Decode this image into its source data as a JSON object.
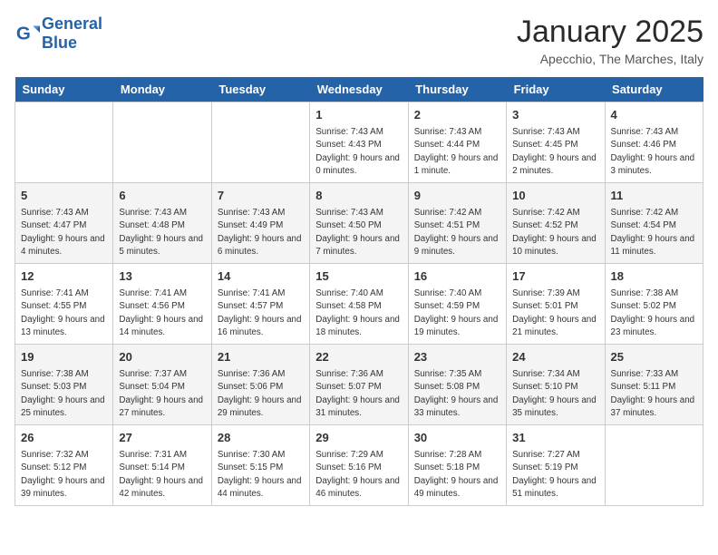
{
  "header": {
    "logo_line1": "General",
    "logo_line2": "Blue",
    "month_title": "January 2025",
    "location": "Apecchio, The Marches, Italy"
  },
  "weekdays": [
    "Sunday",
    "Monday",
    "Tuesday",
    "Wednesday",
    "Thursday",
    "Friday",
    "Saturday"
  ],
  "weeks": [
    [
      {
        "day": "",
        "info": ""
      },
      {
        "day": "",
        "info": ""
      },
      {
        "day": "",
        "info": ""
      },
      {
        "day": "1",
        "info": "Sunrise: 7:43 AM\nSunset: 4:43 PM\nDaylight: 9 hours\nand 0 minutes."
      },
      {
        "day": "2",
        "info": "Sunrise: 7:43 AM\nSunset: 4:44 PM\nDaylight: 9 hours\nand 1 minute."
      },
      {
        "day": "3",
        "info": "Sunrise: 7:43 AM\nSunset: 4:45 PM\nDaylight: 9 hours\nand 2 minutes."
      },
      {
        "day": "4",
        "info": "Sunrise: 7:43 AM\nSunset: 4:46 PM\nDaylight: 9 hours\nand 3 minutes."
      }
    ],
    [
      {
        "day": "5",
        "info": "Sunrise: 7:43 AM\nSunset: 4:47 PM\nDaylight: 9 hours\nand 4 minutes."
      },
      {
        "day": "6",
        "info": "Sunrise: 7:43 AM\nSunset: 4:48 PM\nDaylight: 9 hours\nand 5 minutes."
      },
      {
        "day": "7",
        "info": "Sunrise: 7:43 AM\nSunset: 4:49 PM\nDaylight: 9 hours\nand 6 minutes."
      },
      {
        "day": "8",
        "info": "Sunrise: 7:43 AM\nSunset: 4:50 PM\nDaylight: 9 hours\nand 7 minutes."
      },
      {
        "day": "9",
        "info": "Sunrise: 7:42 AM\nSunset: 4:51 PM\nDaylight: 9 hours\nand 9 minutes."
      },
      {
        "day": "10",
        "info": "Sunrise: 7:42 AM\nSunset: 4:52 PM\nDaylight: 9 hours\nand 10 minutes."
      },
      {
        "day": "11",
        "info": "Sunrise: 7:42 AM\nSunset: 4:54 PM\nDaylight: 9 hours\nand 11 minutes."
      }
    ],
    [
      {
        "day": "12",
        "info": "Sunrise: 7:41 AM\nSunset: 4:55 PM\nDaylight: 9 hours\nand 13 minutes."
      },
      {
        "day": "13",
        "info": "Sunrise: 7:41 AM\nSunset: 4:56 PM\nDaylight: 9 hours\nand 14 minutes."
      },
      {
        "day": "14",
        "info": "Sunrise: 7:41 AM\nSunset: 4:57 PM\nDaylight: 9 hours\nand 16 minutes."
      },
      {
        "day": "15",
        "info": "Sunrise: 7:40 AM\nSunset: 4:58 PM\nDaylight: 9 hours\nand 18 minutes."
      },
      {
        "day": "16",
        "info": "Sunrise: 7:40 AM\nSunset: 4:59 PM\nDaylight: 9 hours\nand 19 minutes."
      },
      {
        "day": "17",
        "info": "Sunrise: 7:39 AM\nSunset: 5:01 PM\nDaylight: 9 hours\nand 21 minutes."
      },
      {
        "day": "18",
        "info": "Sunrise: 7:38 AM\nSunset: 5:02 PM\nDaylight: 9 hours\nand 23 minutes."
      }
    ],
    [
      {
        "day": "19",
        "info": "Sunrise: 7:38 AM\nSunset: 5:03 PM\nDaylight: 9 hours\nand 25 minutes."
      },
      {
        "day": "20",
        "info": "Sunrise: 7:37 AM\nSunset: 5:04 PM\nDaylight: 9 hours\nand 27 minutes."
      },
      {
        "day": "21",
        "info": "Sunrise: 7:36 AM\nSunset: 5:06 PM\nDaylight: 9 hours\nand 29 minutes."
      },
      {
        "day": "22",
        "info": "Sunrise: 7:36 AM\nSunset: 5:07 PM\nDaylight: 9 hours\nand 31 minutes."
      },
      {
        "day": "23",
        "info": "Sunrise: 7:35 AM\nSunset: 5:08 PM\nDaylight: 9 hours\nand 33 minutes."
      },
      {
        "day": "24",
        "info": "Sunrise: 7:34 AM\nSunset: 5:10 PM\nDaylight: 9 hours\nand 35 minutes."
      },
      {
        "day": "25",
        "info": "Sunrise: 7:33 AM\nSunset: 5:11 PM\nDaylight: 9 hours\nand 37 minutes."
      }
    ],
    [
      {
        "day": "26",
        "info": "Sunrise: 7:32 AM\nSunset: 5:12 PM\nDaylight: 9 hours\nand 39 minutes."
      },
      {
        "day": "27",
        "info": "Sunrise: 7:31 AM\nSunset: 5:14 PM\nDaylight: 9 hours\nand 42 minutes."
      },
      {
        "day": "28",
        "info": "Sunrise: 7:30 AM\nSunset: 5:15 PM\nDaylight: 9 hours\nand 44 minutes."
      },
      {
        "day": "29",
        "info": "Sunrise: 7:29 AM\nSunset: 5:16 PM\nDaylight: 9 hours\nand 46 minutes."
      },
      {
        "day": "30",
        "info": "Sunrise: 7:28 AM\nSunset: 5:18 PM\nDaylight: 9 hours\nand 49 minutes."
      },
      {
        "day": "31",
        "info": "Sunrise: 7:27 AM\nSunset: 5:19 PM\nDaylight: 9 hours\nand 51 minutes."
      },
      {
        "day": "",
        "info": ""
      }
    ]
  ]
}
